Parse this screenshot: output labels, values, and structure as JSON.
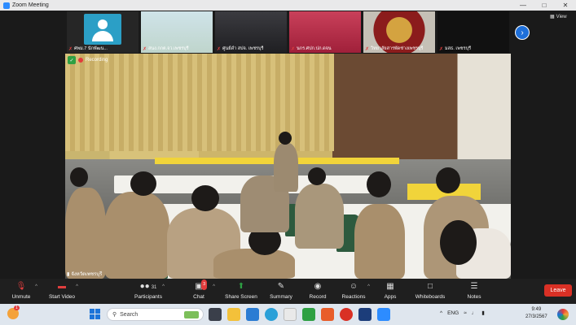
{
  "window": {
    "title": "Zoom Meeting"
  },
  "view_label": "View",
  "thumbnails": [
    {
      "name": "ศพม.7 นักพัฒน..."
    },
    {
      "name": "สนง.กกต.จว.เพชรบุรี"
    },
    {
      "name": "ศูนย์ดำ สปจ. เพชรบุรี"
    },
    {
      "name": "นกร.ศปก.ปภ.ดจน"
    },
    {
      "name": "วิทยาลัยสารพัดช่างเพชรบุรี"
    },
    {
      "name": "มสธ. เพชรบุรี"
    }
  ],
  "main_video": {
    "recording_label": "Recording",
    "speaker_label": "จังหวัดเพชรบุรี"
  },
  "toolbar": {
    "unmute": "Unmute",
    "start_video": "Start Video",
    "participants": "Participants",
    "participants_count": "31",
    "chat": "Chat",
    "chat_badge": "3",
    "share_screen": "Share Screen",
    "summary": "Summary",
    "record": "Record",
    "reactions": "Reactions",
    "apps": "Apps",
    "whiteboards": "Whiteboards",
    "notes": "Notes",
    "leave": "Leave"
  },
  "taskbar": {
    "weather_badge": "1",
    "search_placeholder": "Search",
    "language": "ENG",
    "time": "9:49",
    "date": "27/3/2567"
  },
  "colors": {
    "accent": "#2d8cff",
    "leave": "#d93025",
    "share": "#2ea043"
  }
}
